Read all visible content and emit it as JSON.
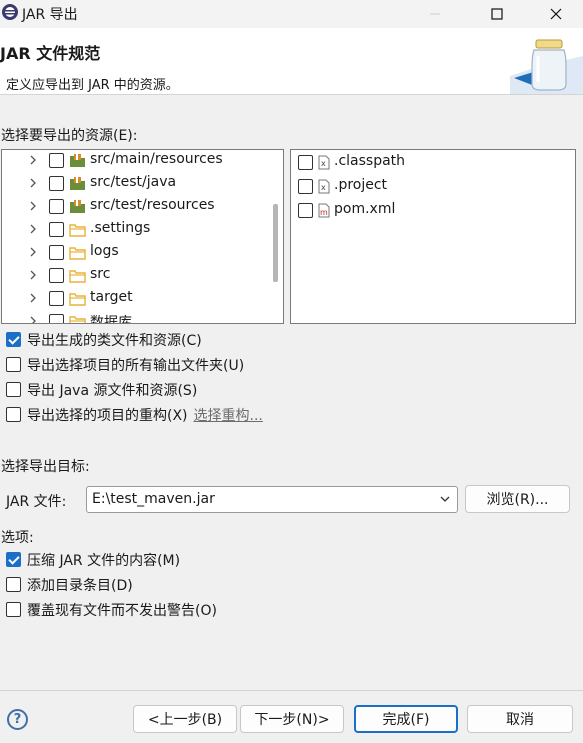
{
  "window": {
    "title": "JAR 导出",
    "minimize_icon": "minimize-icon",
    "maximize_icon": "maximize-icon",
    "close_icon": "close-icon"
  },
  "header": {
    "title": "JAR 文件规范",
    "description": "定义应导出到 JAR 中的资源。",
    "graphic": "jar-icon"
  },
  "resources": {
    "label": "选择要导出的资源(E):",
    "tree_items": [
      {
        "label": "src/main/resources",
        "icon": "package-folder-icon",
        "checked": false
      },
      {
        "label": "src/test/java",
        "icon": "package-folder-icon",
        "checked": false
      },
      {
        "label": "src/test/resources",
        "icon": "package-folder-icon",
        "checked": false
      },
      {
        "label": ".settings",
        "icon": "folder-icon",
        "checked": false
      },
      {
        "label": "logs",
        "icon": "folder-icon",
        "checked": false
      },
      {
        "label": "src",
        "icon": "folder-icon",
        "checked": false
      },
      {
        "label": "target",
        "icon": "folder-icon",
        "checked": false
      },
      {
        "label": "数据库",
        "icon": "folder-icon",
        "checked": false
      }
    ],
    "files": [
      {
        "label": ".classpath",
        "icon": "xml-file-icon",
        "checked": false
      },
      {
        "label": ".project",
        "icon": "xml-file-icon",
        "checked": false
      },
      {
        "label": "pom.xml",
        "icon": "maven-file-icon",
        "checked": false
      }
    ]
  },
  "options_top": [
    {
      "label": "导出生成的类文件和资源(C)",
      "checked": true
    },
    {
      "label": "导出选择项目的所有输出文件夹(U)",
      "checked": false
    },
    {
      "label": "导出 Java 源文件和资源(S)",
      "checked": false
    },
    {
      "label": "导出选择的项目的重构(X)",
      "checked": false,
      "link": "选择重构..."
    }
  ],
  "destination": {
    "label": "选择导出目标:",
    "jar_label": "JAR 文件:",
    "jar_value": "E:\\test_maven.jar",
    "browse_label": "浏览(R)..."
  },
  "options": {
    "label": "选项:",
    "items": [
      {
        "label": "压缩 JAR 文件的内容(M)",
        "checked": true
      },
      {
        "label": "添加目录条目(D)",
        "checked": false
      },
      {
        "label": "覆盖现有文件而不发出警告(O)",
        "checked": false
      }
    ]
  },
  "footer": {
    "help": "?",
    "back": "<上一步(B)",
    "next": "下一步(N)>",
    "finish": "完成(F)",
    "cancel": "取消"
  },
  "colors": {
    "accent": "#1c6fc9",
    "package_icon": "#6a8e3a",
    "folder_icon": "#e8b33a"
  }
}
